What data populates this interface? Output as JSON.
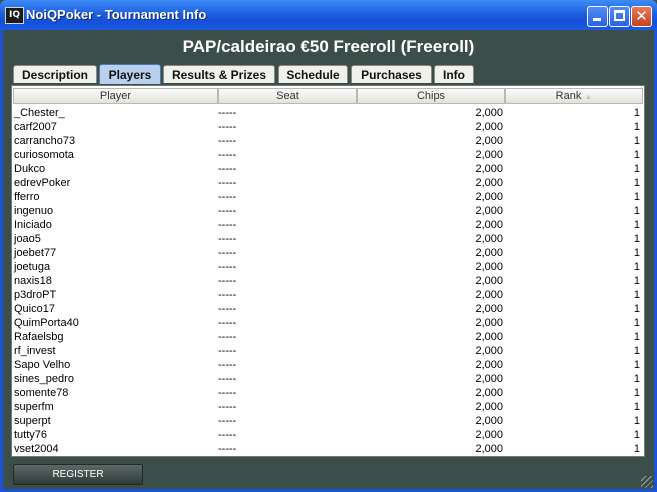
{
  "window": {
    "title": "NoiQPoker - Tournament Info",
    "icon_text": "IQ"
  },
  "tournament": {
    "name": "PAP/caldeirao €50 Freeroll (Freeroll)"
  },
  "tabs": [
    {
      "label": "Description",
      "active": false
    },
    {
      "label": "Players",
      "active": true
    },
    {
      "label": "Results & Prizes",
      "active": false
    },
    {
      "label": "Schedule",
      "active": false
    },
    {
      "label": "Purchases",
      "active": false
    },
    {
      "label": "Info",
      "active": false
    }
  ],
  "table": {
    "columns": [
      "Player",
      "Seat",
      "Chips",
      "Rank"
    ],
    "sort_column": "Rank",
    "sort_indicator": "▲",
    "rows": [
      {
        "player": "_Chester_",
        "seat": "-----",
        "chips": "2,000",
        "rank": "1"
      },
      {
        "player": "carf2007",
        "seat": "-----",
        "chips": "2,000",
        "rank": "1"
      },
      {
        "player": "carrancho73",
        "seat": "-----",
        "chips": "2,000",
        "rank": "1"
      },
      {
        "player": "curiosomota",
        "seat": "-----",
        "chips": "2,000",
        "rank": "1"
      },
      {
        "player": "Dukco",
        "seat": "-----",
        "chips": "2,000",
        "rank": "1"
      },
      {
        "player": "edrevPoker",
        "seat": "-----",
        "chips": "2,000",
        "rank": "1"
      },
      {
        "player": "fferro",
        "seat": "-----",
        "chips": "2,000",
        "rank": "1"
      },
      {
        "player": "ingenuo",
        "seat": "-----",
        "chips": "2,000",
        "rank": "1"
      },
      {
        "player": "Iniciado",
        "seat": "-----",
        "chips": "2,000",
        "rank": "1"
      },
      {
        "player": "joao5",
        "seat": "-----",
        "chips": "2,000",
        "rank": "1"
      },
      {
        "player": "joebet77",
        "seat": "-----",
        "chips": "2,000",
        "rank": "1"
      },
      {
        "player": "joetuga",
        "seat": "-----",
        "chips": "2,000",
        "rank": "1"
      },
      {
        "player": "naxis18",
        "seat": "-----",
        "chips": "2,000",
        "rank": "1"
      },
      {
        "player": "p3droPT",
        "seat": "-----",
        "chips": "2,000",
        "rank": "1"
      },
      {
        "player": "Quico17",
        "seat": "-----",
        "chips": "2,000",
        "rank": "1"
      },
      {
        "player": "QuimPorta40",
        "seat": "-----",
        "chips": "2,000",
        "rank": "1"
      },
      {
        "player": "Rafaelsbg",
        "seat": "-----",
        "chips": "2,000",
        "rank": "1"
      },
      {
        "player": "rf_invest",
        "seat": "-----",
        "chips": "2,000",
        "rank": "1"
      },
      {
        "player": "Sapo Velho",
        "seat": "-----",
        "chips": "2,000",
        "rank": "1"
      },
      {
        "player": "sines_pedro",
        "seat": "-----",
        "chips": "2,000",
        "rank": "1"
      },
      {
        "player": "somente78",
        "seat": "-----",
        "chips": "2,000",
        "rank": "1"
      },
      {
        "player": "superfm",
        "seat": "-----",
        "chips": "2,000",
        "rank": "1"
      },
      {
        "player": "superpt",
        "seat": "-----",
        "chips": "2,000",
        "rank": "1"
      },
      {
        "player": "tutty76",
        "seat": "-----",
        "chips": "2,000",
        "rank": "1"
      },
      {
        "player": "vset2004",
        "seat": "-----",
        "chips": "2,000",
        "rank": "1"
      }
    ]
  },
  "actions": {
    "register_label": "REGISTER"
  },
  "icons": {
    "minimize": "minimize-icon",
    "maximize": "maximize-icon",
    "close": "close-icon",
    "close_glyph": "✕"
  },
  "colors": {
    "titlebar": "#1f5fe0",
    "background": "#3b4e4a",
    "active_tab": "#b9d1ee",
    "close_button": "#c4421e"
  }
}
